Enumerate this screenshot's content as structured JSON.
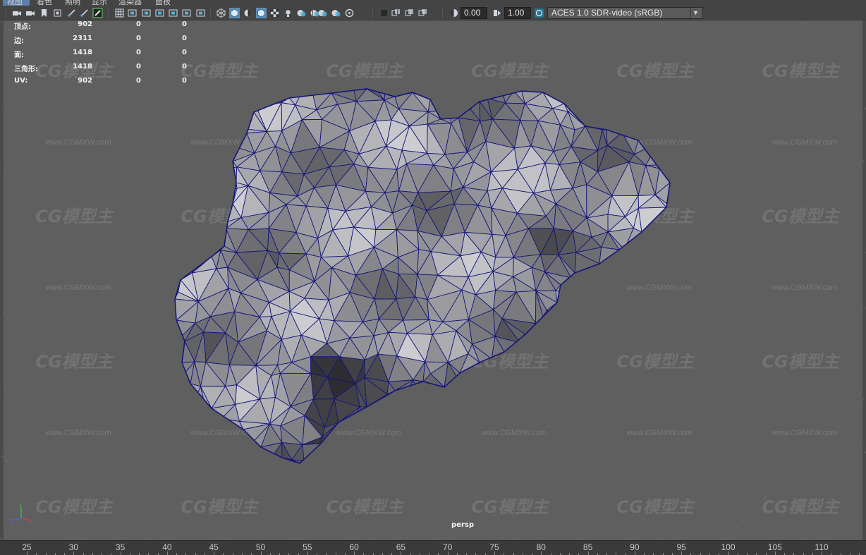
{
  "menu": {
    "items": [
      "视图",
      "着色",
      "照明",
      "显示",
      "渲染器",
      "面板"
    ]
  },
  "toolbar": {
    "exposure_value": "0.00",
    "gamma_value": "1.00",
    "color_space": "ACES 1.0 SDR-video (sRGB)",
    "icons": [
      "camera-select-icon",
      "camera-attributes-icon",
      "bookmark-icon",
      "image-plane-icon",
      "grease-pencil-icon",
      "2d-pan-zoom-icon",
      "grease-pencil-tool-icon",
      "grid-icon",
      "film-gate-icon",
      "resolution-gate-icon",
      "gate-mask-icon",
      "field-chart-icon",
      "safe-action-icon",
      "safe-title-icon",
      "wireframe-icon",
      "smooth-shade-icon",
      "default-material-icon",
      "wireframe-on-shaded-icon",
      "textured-icon",
      "use-all-lights-icon",
      "shadows-icon",
      "screen-space-ao-icon",
      "motion-blur-icon",
      "multisample-aa-icon",
      "depth-of-field-icon",
      "isolate-select-icon",
      "xray-icon",
      "xray-joints-icon",
      "backface-culling-icon",
      "exposure-icon",
      "gamma-icon",
      "color-management-icon"
    ]
  },
  "hud": {
    "rows": [
      {
        "label": "顶点:",
        "values": [
          "902",
          "0",
          "0"
        ]
      },
      {
        "label": "边:",
        "values": [
          "2311",
          "0",
          "0"
        ]
      },
      {
        "label": "面:",
        "values": [
          "1418",
          "0",
          "0"
        ]
      },
      {
        "label": "三角形:",
        "values": [
          "1418",
          "0",
          "0"
        ]
      },
      {
        "label": "UV:",
        "values": [
          "902",
          "0",
          "0"
        ]
      }
    ]
  },
  "viewport": {
    "camera": "persp",
    "mesh_color": "#8a8a8e",
    "wire_color": "#15157a",
    "background": "#5f5f5f"
  },
  "axis": {
    "y": "Y",
    "z": "Z",
    "x": "X"
  },
  "watermark": {
    "logo": "CG模型主",
    "url": "www.CGMXW.com"
  },
  "timeline": {
    "ticks": [
      "25",
      "30",
      "35",
      "40",
      "45",
      "50",
      "55",
      "60",
      "65",
      "70",
      "75",
      "80",
      "85",
      "90",
      "95",
      "100",
      "105",
      "110"
    ]
  }
}
